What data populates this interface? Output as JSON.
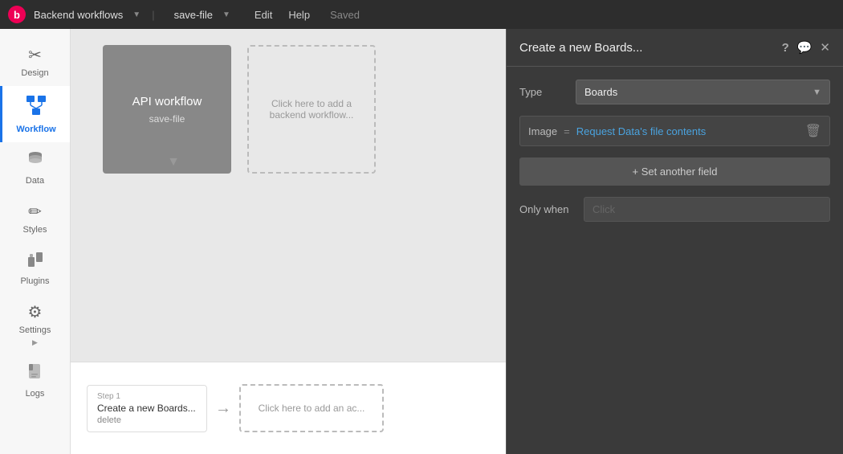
{
  "topbar": {
    "logo_text": "b",
    "app_name": "Backend workflows",
    "workflow_name": "save-file",
    "nav": {
      "edit": "Edit",
      "help": "Help",
      "status": "Saved"
    }
  },
  "sidebar": {
    "items": [
      {
        "id": "design",
        "label": "Design",
        "icon": "✂"
      },
      {
        "id": "workflow",
        "label": "Workflow",
        "icon": "⊞",
        "active": true
      },
      {
        "id": "data",
        "label": "Data",
        "icon": "⊙"
      },
      {
        "id": "styles",
        "label": "Styles",
        "icon": "✏"
      },
      {
        "id": "plugins",
        "label": "Plugins",
        "icon": "⚙"
      },
      {
        "id": "settings",
        "label": "Settings",
        "icon": "⚙"
      },
      {
        "id": "logs",
        "label": "Logs",
        "icon": "📄"
      }
    ]
  },
  "canvas": {
    "api_block": {
      "title": "API workflow",
      "subtitle": "save-file"
    },
    "add_block": {
      "text": "Click here to add a backend workflow..."
    }
  },
  "steps": {
    "step1": {
      "label": "Step 1",
      "name": "Create a new Boards...",
      "delete": "delete"
    },
    "add_action": {
      "text": "Click here to add an ac..."
    }
  },
  "modal": {
    "title": "Create a new Boards...",
    "type_label": "Type",
    "type_value": "Boards",
    "image_label": "Image",
    "image_eq": "=",
    "image_value": "Request Data's file contents",
    "add_field_btn": "+ Set another field",
    "only_when_label": "Only when",
    "only_when_placeholder": "Click",
    "help_icon": "?",
    "chat_icon": "💬",
    "close_icon": "✕"
  }
}
